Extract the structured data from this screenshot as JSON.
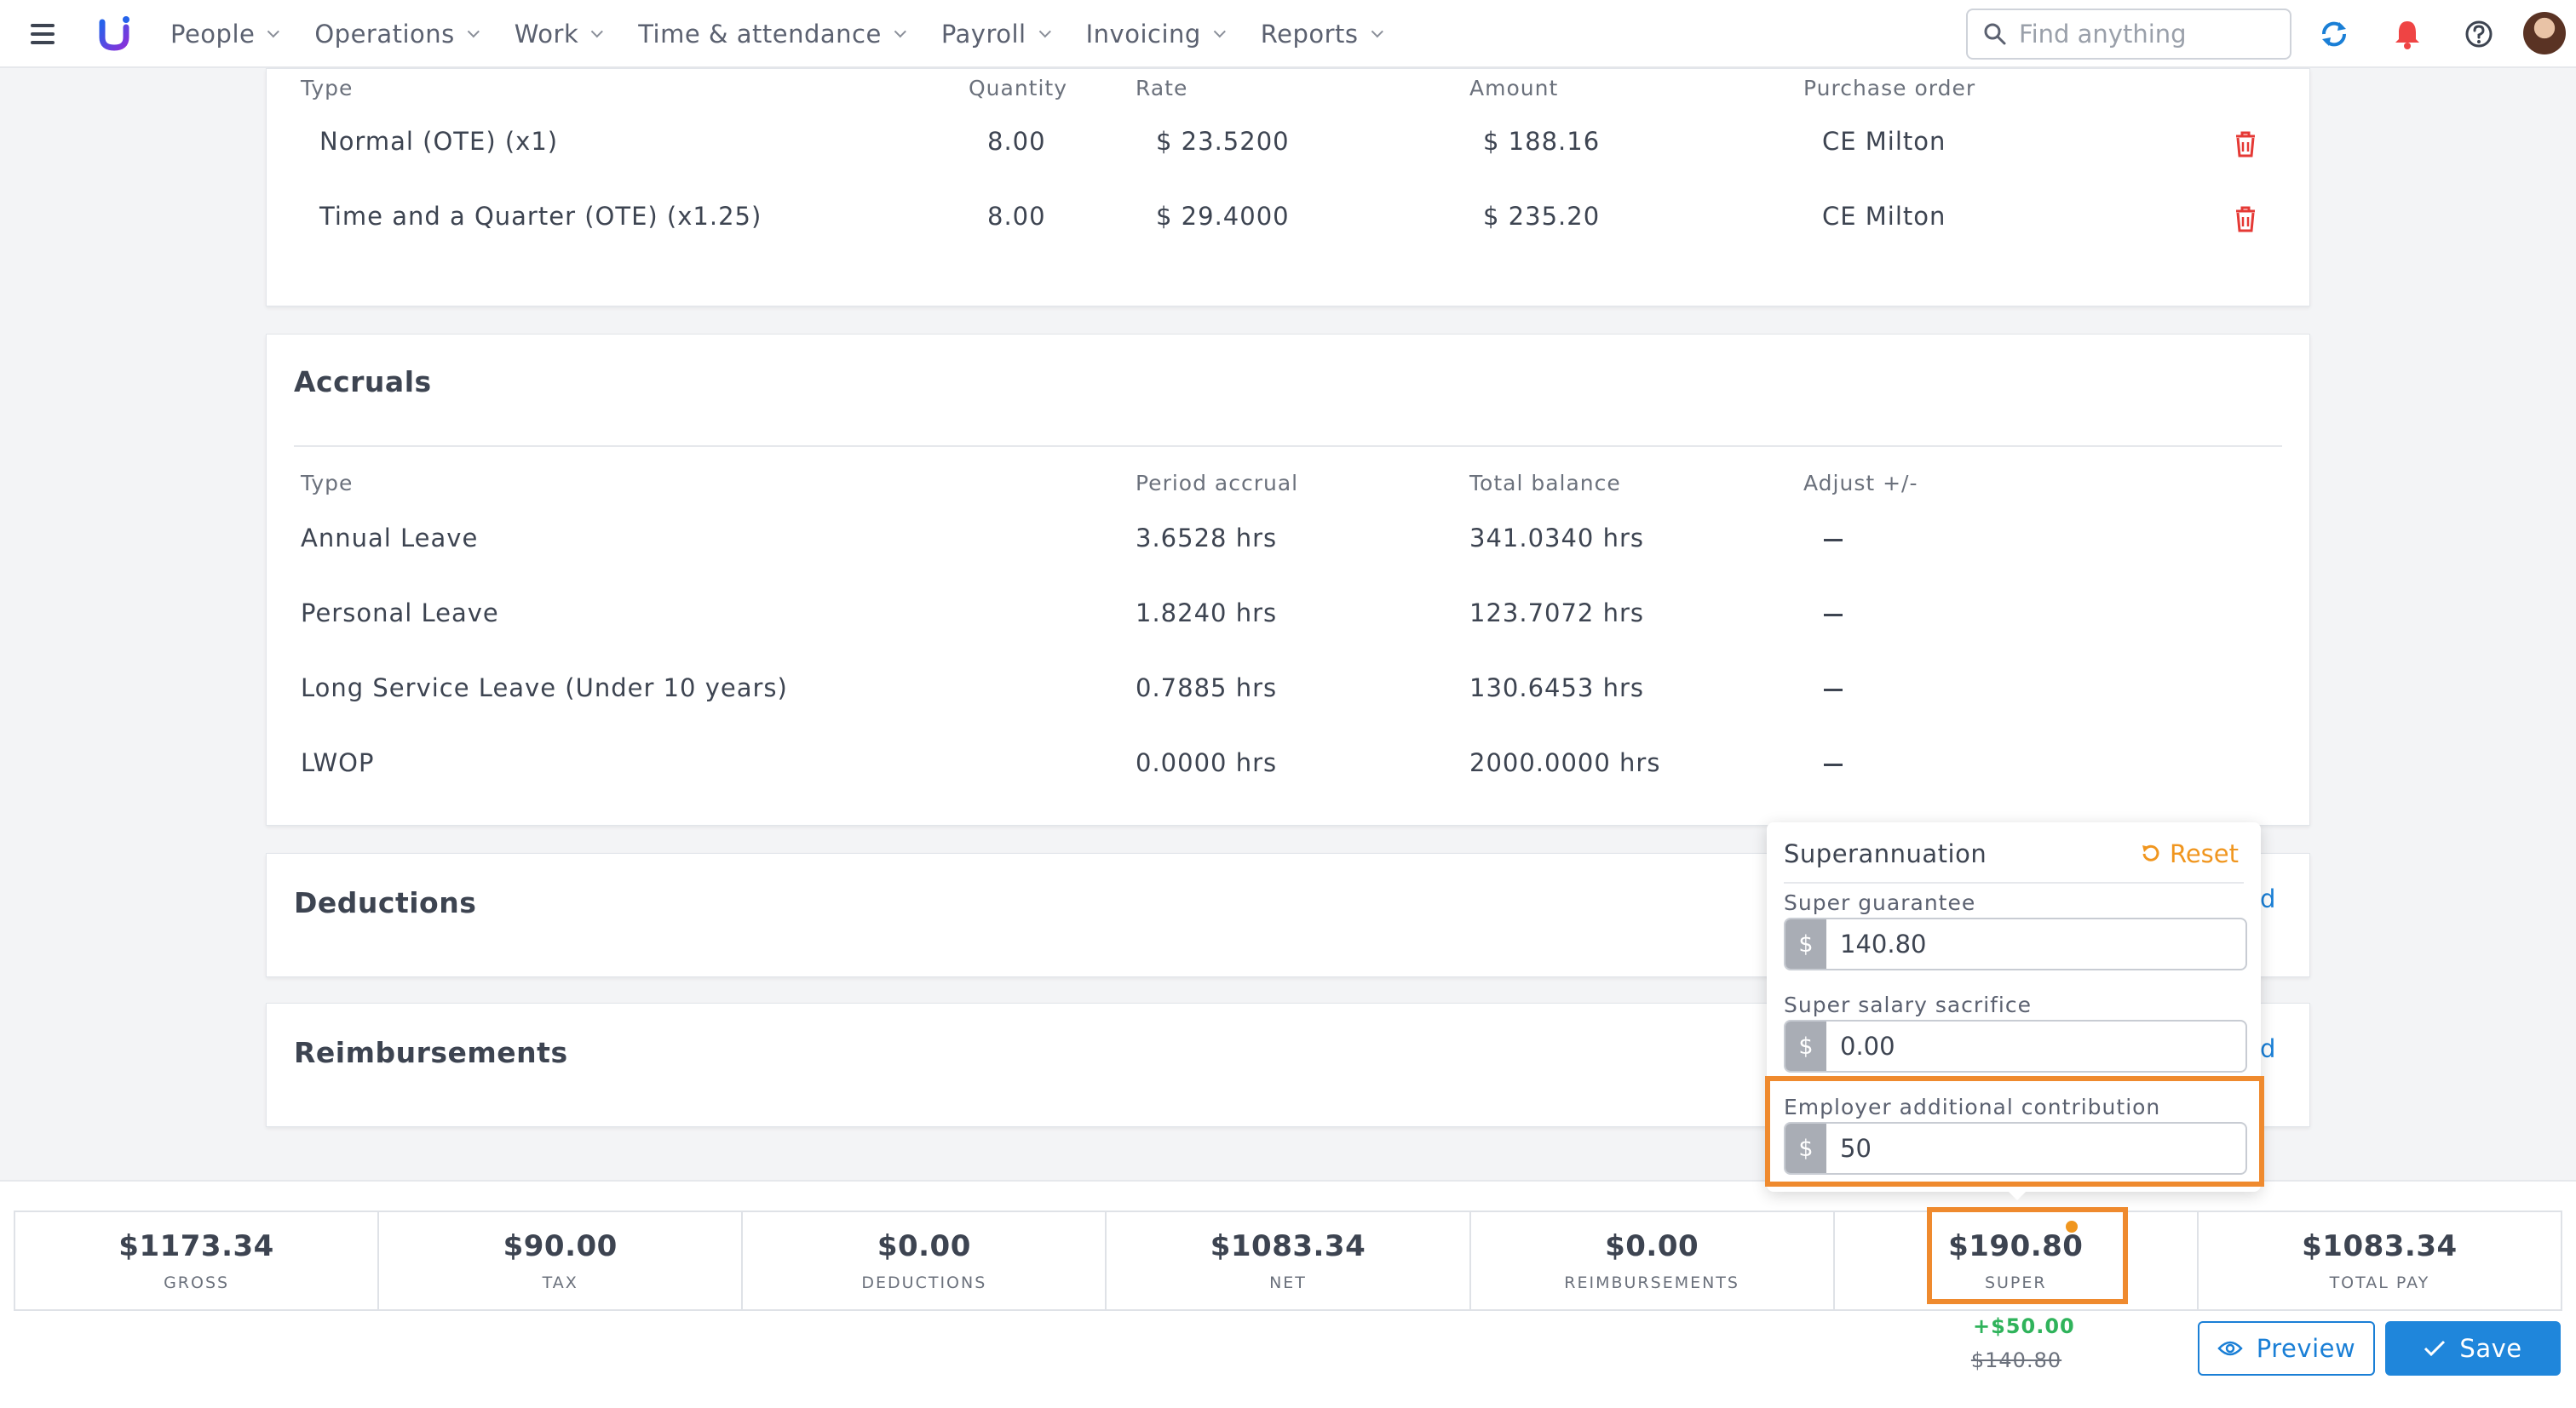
{
  "nav": {
    "items": [
      {
        "label": "People"
      },
      {
        "label": "Operations"
      },
      {
        "label": "Work"
      },
      {
        "label": "Time & attendance"
      },
      {
        "label": "Payroll"
      },
      {
        "label": "Invoicing"
      },
      {
        "label": "Reports"
      }
    ],
    "search_placeholder": "Find anything",
    "icons": [
      "menu-icon",
      "logo",
      "search-icon",
      "refresh-icon",
      "bell-icon",
      "help-icon",
      "avatar"
    ],
    "accent_color": "#1a7fd6",
    "bell_color": "#ef4444"
  },
  "earnings": {
    "headers": {
      "type": "Type",
      "quantity": "Quantity",
      "rate": "Rate",
      "amount": "Amount",
      "po": "Purchase order"
    },
    "rows": [
      {
        "type": "Normal (OTE) (x1)",
        "quantity": "8.00",
        "rate": "$ 23.5200",
        "amount": "$ 188.16",
        "po": "CE Milton"
      },
      {
        "type": "Time and a Quarter (OTE) (x1.25)",
        "quantity": "8.00",
        "rate": "$ 29.4000",
        "amount": "$ 235.20",
        "po": "CE Milton"
      }
    ]
  },
  "accruals": {
    "title": "Accruals",
    "headers": {
      "type": "Type",
      "period": "Period accrual",
      "total": "Total balance",
      "adjust": "Adjust +/-"
    },
    "rows": [
      {
        "type": "Annual Leave",
        "period": "3.6528 hrs",
        "total": "341.0340 hrs"
      },
      {
        "type": "Personal Leave",
        "period": "1.8240 hrs",
        "total": "123.7072 hrs"
      },
      {
        "type": "Long Service Leave (Under 10 years)",
        "period": "0.7885 hrs",
        "total": "130.6453 hrs"
      },
      {
        "type": "LWOP",
        "period": "0.0000 hrs",
        "total": "2000.0000 hrs"
      }
    ]
  },
  "deductions": {
    "title": "Deductions",
    "add_link": "d"
  },
  "reimbursements": {
    "title": "Reimbursements",
    "add_link": "d"
  },
  "super_popover": {
    "title": "Superannuation",
    "reset_label": "Reset",
    "fields": [
      {
        "label": "Super guarantee",
        "currency": "$",
        "value": "140.80"
      },
      {
        "label": "Super salary sacrifice",
        "currency": "$",
        "value": "0.00"
      },
      {
        "label": "Employer additional contribution",
        "currency": "$",
        "value": "50"
      }
    ],
    "highlight_color": "#ef8a2e"
  },
  "summary": {
    "cells": [
      {
        "value": "$1173.34",
        "label": "GROSS"
      },
      {
        "value": "$90.00",
        "label": "TAX"
      },
      {
        "value": "$0.00",
        "label": "DEDUCTIONS"
      },
      {
        "value": "$1083.34",
        "label": "NET"
      },
      {
        "value": "$0.00",
        "label": "REIMBURSEMENTS"
      },
      {
        "value": "$190.80",
        "label": "SUPER"
      },
      {
        "value": "$1083.34",
        "label": "TOTAL PAY"
      }
    ],
    "super_delta": "+$50.00",
    "super_previous": "$140.80"
  },
  "actions": {
    "preview_label": "Preview",
    "save_label": "Save"
  }
}
